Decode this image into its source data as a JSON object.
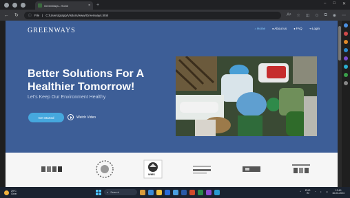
{
  "browser": {
    "tab_title": "GreenWays - Home",
    "url": "C:/Users/grapp/Visitors/www/Greenways.html",
    "file_label": "File"
  },
  "site": {
    "brand": "GREENWAYS",
    "nav": [
      {
        "label": "Home",
        "active": true
      },
      {
        "label": "About us",
        "active": false
      },
      {
        "label": "FAQ",
        "active": false
      },
      {
        "label": "Login",
        "active": false
      }
    ],
    "headline": "Better Solutions For A Healthier Tomorrow!",
    "subheadline": "Let's Keep Our Environment Healthy",
    "cta_label": "Get Started",
    "watch_label": "Watch Video",
    "partner_badge_text": "WMS"
  },
  "taskbar": {
    "weather_temp": "29°C",
    "weather_desc": "Clear",
    "search_placeholder": "Search",
    "lang_line1": "ENG",
    "lang_line2": "IN",
    "time": "13:49",
    "date": "16-03-2024"
  },
  "colors": {
    "hero_bg": "#3d5e97",
    "accent": "#46a8de",
    "nav_active": "#8fd3ff"
  }
}
